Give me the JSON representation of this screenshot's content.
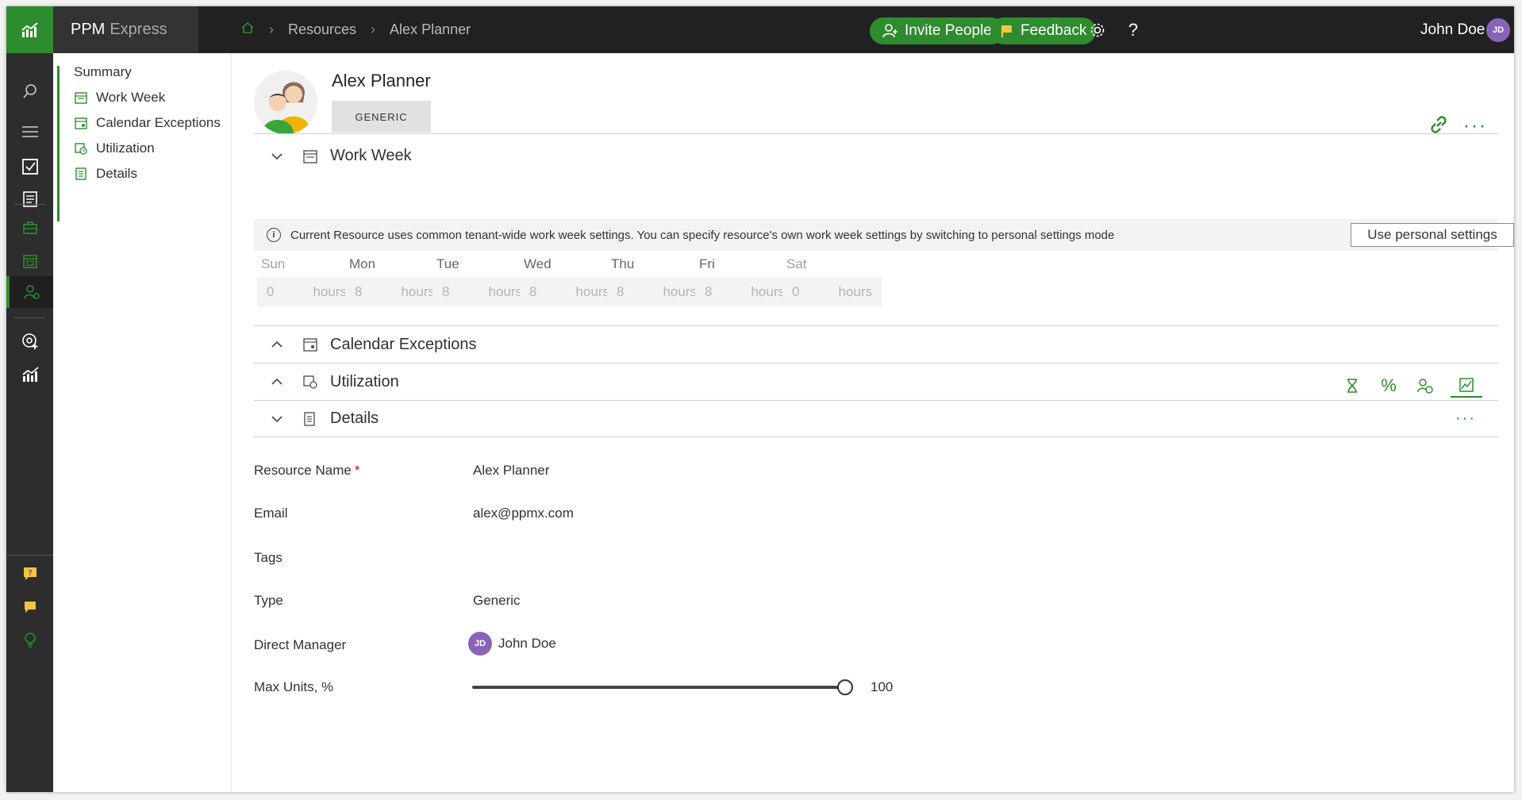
{
  "app": {
    "name": "PPM",
    "subname": "Express"
  },
  "breadcrumb": {
    "items": [
      "Resources",
      "Alex Planner"
    ]
  },
  "header": {
    "invite_label": "Invite People",
    "feedback_label": "Feedback",
    "help_label": "?",
    "user_name": "John Doe",
    "user_initials": "JD"
  },
  "section_nav": {
    "items": [
      {
        "label": "Summary"
      },
      {
        "label": "Work Week"
      },
      {
        "label": "Calendar Exceptions"
      },
      {
        "label": "Utilization"
      },
      {
        "label": "Details"
      }
    ]
  },
  "resource": {
    "name": "Alex Planner",
    "type_badge": "GENERIC"
  },
  "work_week": {
    "title": "Work Week",
    "info_text": "Current Resource uses common tenant-wide work week settings. You can specify resource's own work week settings by switching to personal settings mode",
    "info_button": "Use personal settings",
    "unit": "hours",
    "days": [
      {
        "label": "Sun",
        "value": "0"
      },
      {
        "label": "Mon",
        "value": "8"
      },
      {
        "label": "Tue",
        "value": "8"
      },
      {
        "label": "Wed",
        "value": "8"
      },
      {
        "label": "Thu",
        "value": "8"
      },
      {
        "label": "Fri",
        "value": "8"
      },
      {
        "label": "Sat",
        "value": "0"
      }
    ]
  },
  "calendar_exceptions": {
    "title": "Calendar Exceptions"
  },
  "utilization": {
    "title": "Utilization",
    "percent_symbol": "%"
  },
  "details": {
    "title": "Details",
    "more": "···",
    "fields": {
      "resource_name_label": "Resource Name",
      "required_mark": "*",
      "resource_name_value": "Alex Planner",
      "email_label": "Email",
      "email_value": "alex@ppmx.com",
      "tags_label": "Tags",
      "type_label": "Type",
      "type_value": "Generic",
      "manager_label": "Direct Manager",
      "manager_initials": "JD",
      "manager_value": "John Doe",
      "max_units_label": "Max Units, %",
      "max_units_value": "100"
    }
  },
  "more_top": "···",
  "colors": {
    "accent": "#2e8b2e",
    "topbar": "#212121",
    "rail": "#2d2d2d",
    "avatar": "#8764b8"
  }
}
